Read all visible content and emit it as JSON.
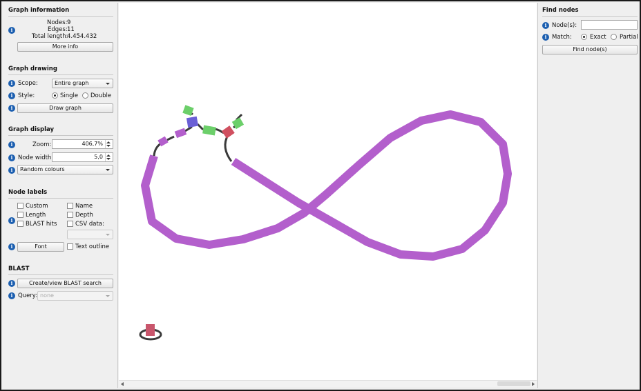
{
  "graph_information": {
    "title": "Graph information",
    "nodes_label": "Nodes:",
    "nodes_value": "9",
    "edges_label": "Edges:",
    "edges_value": "11",
    "length_label": "Total length:",
    "length_value": "4.454.432",
    "more_info_button": "More info"
  },
  "graph_drawing": {
    "title": "Graph drawing",
    "scope_label": "Scope:",
    "scope_value": "Entire graph",
    "style_label": "Style:",
    "style_single": "Single",
    "style_double": "Double",
    "style_selected": "Single",
    "draw_button": "Draw graph"
  },
  "graph_display": {
    "title": "Graph display",
    "zoom_label": "Zoom:",
    "zoom_value": "406,7%",
    "node_width_label": "Node width:",
    "node_width_value": "5,0",
    "colour_scheme": "Random colours"
  },
  "node_labels": {
    "title": "Node labels",
    "custom": "Custom",
    "name": "Name",
    "length": "Length",
    "depth": "Depth",
    "blast_hits": "BLAST hits",
    "csv_data": "CSV data:",
    "font_button": "Font",
    "text_outline": "Text outline"
  },
  "blast": {
    "title": "BLAST",
    "create_button": "Create/view BLAST search",
    "query_label": "Query:",
    "query_value": "none"
  },
  "find_nodes": {
    "title": "Find nodes",
    "nodes_label": "Node(s):",
    "nodes_value": "",
    "match_label": "Match:",
    "match_exact": "Exact",
    "match_partial": "Partial",
    "match_selected": "Exact",
    "find_button": "Find node(s)"
  },
  "colors": {
    "big_loop": "#b35fcc",
    "edge": "#3a3a3a",
    "node_green": "#6ccf6a",
    "node_blue": "#6a5fd6",
    "node_red": "#d05060",
    "node_pink": "#c9566c",
    "node_purple": "#b35fcc",
    "info_icon": "#1c5fb0"
  }
}
